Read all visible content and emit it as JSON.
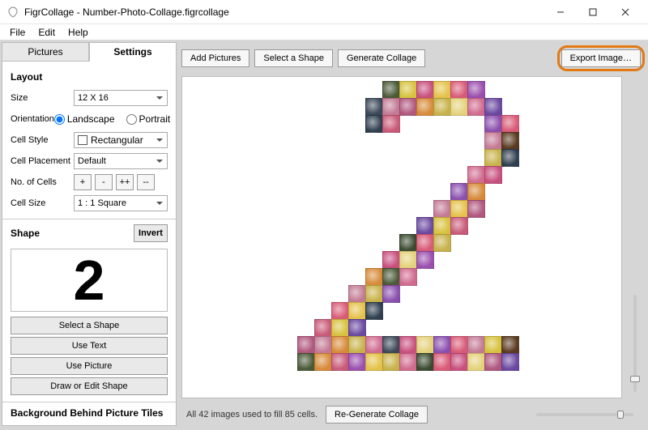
{
  "window": {
    "title": "FigrCollage - Number-Photo-Collage.figrcollage"
  },
  "menu": {
    "file": "File",
    "edit": "Edit",
    "help": "Help"
  },
  "tabs": {
    "pictures": "Pictures",
    "settings": "Settings"
  },
  "layout": {
    "header": "Layout",
    "size_label": "Size",
    "size_value": "12 X 16",
    "orientation_label": "Orientation",
    "landscape": "Landscape",
    "portrait": "Portrait",
    "cellstyle_label": "Cell Style",
    "cellstyle_value": "Rectangular",
    "cellplacement_label": "Cell Placement",
    "cellplacement_value": "Default",
    "nocells_label": "No. of Cells",
    "nocells_buttons": [
      "+",
      "-",
      "++",
      "--"
    ],
    "cellsize_label": "Cell Size",
    "cellsize_value": "1 : 1 Square"
  },
  "shape": {
    "header": "Shape",
    "invert": "Invert",
    "glyph": "2",
    "select": "Select a Shape",
    "usetext": "Use Text",
    "usepicture": "Use Picture",
    "draw": "Draw or Edit Shape"
  },
  "background": {
    "header": "Background Behind Picture Tiles"
  },
  "toolbar": {
    "add": "Add Pictures",
    "select": "Select a Shape",
    "generate": "Generate Collage",
    "export": "Export Image…"
  },
  "status": {
    "text": "All 42 images used to fill 85 cells.",
    "regenerate": "Re-Generate Collage"
  },
  "collage_cells": [
    [
      6,
      0,
      "#4a5a38"
    ],
    [
      7,
      0,
      "#d7c23e"
    ],
    [
      8,
      0,
      "#c84f7e"
    ],
    [
      9,
      0,
      "#e4c24a"
    ],
    [
      10,
      0,
      "#d85a76"
    ],
    [
      11,
      0,
      "#9a4fae"
    ],
    [
      5,
      1,
      "#3a4857"
    ],
    [
      6,
      1,
      "#c37a94"
    ],
    [
      7,
      1,
      "#b0577e"
    ],
    [
      8,
      1,
      "#d78b3a"
    ],
    [
      9,
      1,
      "#c7b24a"
    ],
    [
      10,
      1,
      "#e4d27a"
    ],
    [
      11,
      1,
      "#d06a8e"
    ],
    [
      12,
      1,
      "#6a48a0"
    ],
    [
      5,
      2,
      "#2f3f50"
    ],
    [
      6,
      2,
      "#c85a78"
    ],
    [
      12,
      2,
      "#8a4fae"
    ],
    [
      13,
      2,
      "#d85a76"
    ],
    [
      12,
      3,
      "#c37a94"
    ],
    [
      13,
      3,
      "#5a3a20"
    ],
    [
      12,
      4,
      "#c7b24a"
    ],
    [
      13,
      4,
      "#2f3f50"
    ],
    [
      11,
      5,
      "#d06a8e"
    ],
    [
      12,
      5,
      "#c84f7e"
    ],
    [
      10,
      6,
      "#8a4fae"
    ],
    [
      11,
      6,
      "#d78b3a"
    ],
    [
      9,
      7,
      "#c37a94"
    ],
    [
      10,
      7,
      "#e4c24a"
    ],
    [
      11,
      7,
      "#b0577e"
    ],
    [
      8,
      8,
      "#6a48a0"
    ],
    [
      9,
      8,
      "#d7c23e"
    ],
    [
      10,
      8,
      "#c85a78"
    ],
    [
      7,
      9,
      "#3a4a30"
    ],
    [
      8,
      9,
      "#d85a76"
    ],
    [
      9,
      9,
      "#c7b24a"
    ],
    [
      6,
      10,
      "#c84f7e"
    ],
    [
      7,
      10,
      "#e4d27a"
    ],
    [
      8,
      10,
      "#9a4fae"
    ],
    [
      5,
      11,
      "#d78b3a"
    ],
    [
      6,
      11,
      "#4a5a38"
    ],
    [
      7,
      11,
      "#d06a8e"
    ],
    [
      4,
      12,
      "#c37a94"
    ],
    [
      5,
      12,
      "#c7b24a"
    ],
    [
      6,
      12,
      "#8a4fae"
    ],
    [
      3,
      13,
      "#d85a76"
    ],
    [
      4,
      13,
      "#e4c24a"
    ],
    [
      5,
      13,
      "#2f3f50"
    ],
    [
      2,
      14,
      "#c85a78"
    ],
    [
      3,
      14,
      "#d7c23e"
    ],
    [
      4,
      14,
      "#6a48a0"
    ],
    [
      1,
      15,
      "#b0577e"
    ],
    [
      2,
      15,
      "#c37a94"
    ],
    [
      3,
      15,
      "#d78b3a"
    ],
    [
      4,
      15,
      "#c7b24a"
    ],
    [
      5,
      15,
      "#d06a8e"
    ],
    [
      6,
      15,
      "#3a4857"
    ],
    [
      7,
      15,
      "#c84f7e"
    ],
    [
      8,
      15,
      "#e4d27a"
    ],
    [
      9,
      15,
      "#8a4fae"
    ],
    [
      10,
      15,
      "#d85a76"
    ],
    [
      11,
      15,
      "#c37a94"
    ],
    [
      12,
      15,
      "#d7c23e"
    ],
    [
      13,
      15,
      "#5a3a20"
    ],
    [
      1,
      16,
      "#4a5a38"
    ],
    [
      2,
      16,
      "#d78b3a"
    ],
    [
      3,
      16,
      "#c85a78"
    ],
    [
      4,
      16,
      "#9a4fae"
    ],
    [
      5,
      16,
      "#e4c24a"
    ],
    [
      6,
      16,
      "#c7b24a"
    ],
    [
      7,
      16,
      "#d06a8e"
    ],
    [
      8,
      16,
      "#3a4a30"
    ],
    [
      9,
      16,
      "#d85a76"
    ],
    [
      10,
      16,
      "#c84f7e"
    ],
    [
      11,
      16,
      "#e4d27a"
    ],
    [
      12,
      16,
      "#b0577e"
    ],
    [
      13,
      16,
      "#6a48a0"
    ]
  ]
}
